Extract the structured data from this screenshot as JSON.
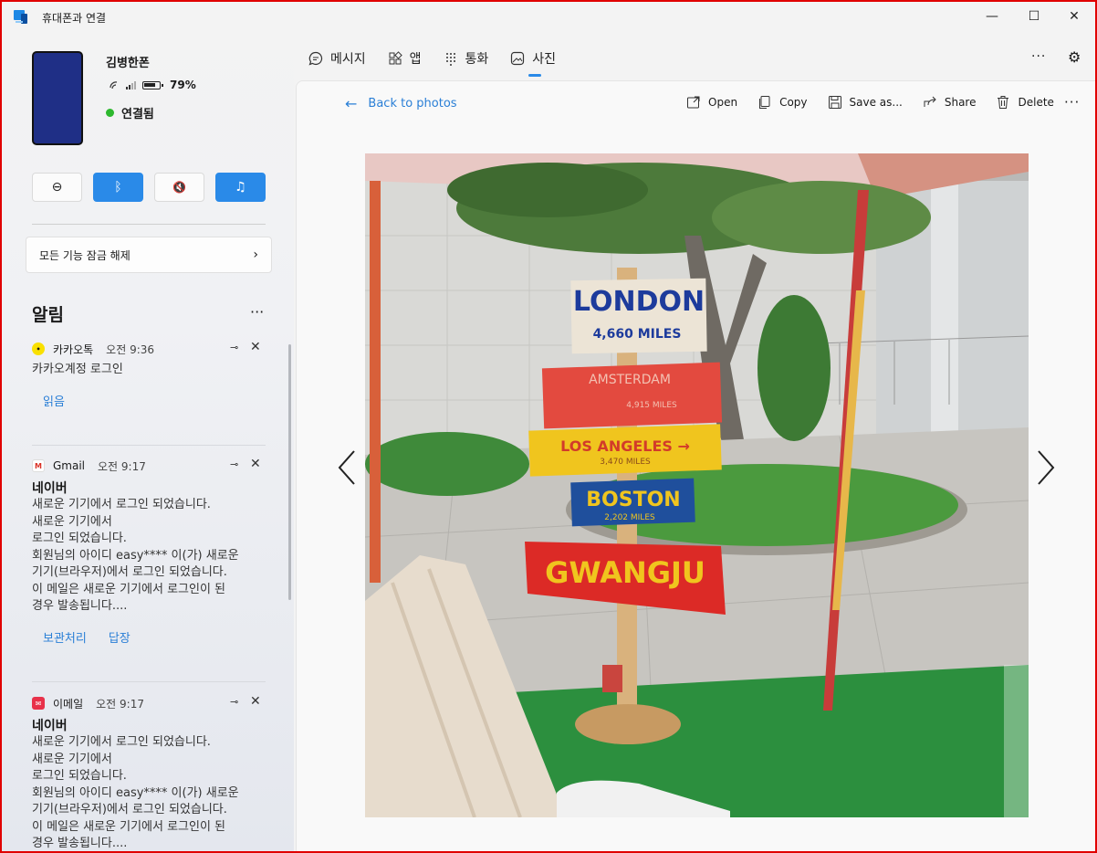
{
  "window": {
    "title": "휴대폰과 연결",
    "minimize": "—",
    "maximize": "☐",
    "close": "✕"
  },
  "phone": {
    "name": "김병한폰",
    "battery": "79%",
    "battery_level": 0.79,
    "status": "연결됨"
  },
  "quick_actions": [
    {
      "name": "dnd",
      "icon": "⊖",
      "active": false
    },
    {
      "name": "bluetooth",
      "icon": "ᛒ",
      "active": true
    },
    {
      "name": "mute",
      "icon": "🔇",
      "active": false
    },
    {
      "name": "music",
      "icon": "♫",
      "active": true
    }
  ],
  "unlock_label": "모든 기능 잠금 해제",
  "notifications": {
    "title": "알림",
    "items": [
      {
        "app": "카카오톡",
        "time": "오전 9:36",
        "icon_color": "#f9e000",
        "sender": "",
        "body": "카카오계정 로그인",
        "actions": [
          "읽음"
        ]
      },
      {
        "app": "Gmail",
        "time": "오전 9:17",
        "icon_color": "#ffffff",
        "sender": "네이버",
        "body": "새로운 기기에서 로그인 되었습니다.\n새로운 기기에서\n로그인 되었습니다.\n회원님의 아이디 easy**** 이(가) 새로운\n기기(브라우저)에서 로그인 되었습니다.\n이 메일은 새로운 기기에서 로그인이 된\n경우 발송됩니다....",
        "actions": [
          "보관처리",
          "답장"
        ]
      },
      {
        "app": "이메일",
        "time": "오전 9:17",
        "icon_color": "#e8314a",
        "sender": "네이버",
        "body": "새로운 기기에서 로그인 되었습니다.\n새로운 기기에서\n로그인 되었습니다.\n 회원님의 아이디 easy**** 이(가) 새로운\n기기(브라우저)에서 로그인 되었습니다.\n이 메일은 새로운 기기에서 로그인이 된\n경우 발송됩니다....",
        "actions": []
      }
    ]
  },
  "nav": {
    "messages": "메시지",
    "apps": "앱",
    "calls": "통화",
    "photos": "사진"
  },
  "photo_view": {
    "back": "Back to photos",
    "open": "Open",
    "copy": "Copy",
    "save": "Save as...",
    "share": "Share",
    "delete": "Delete",
    "signs": [
      "LONDON",
      "4,660 MILES",
      "AMSTERDAM",
      "4,915 MILES",
      "LOS ANGELES →",
      "3,470 MILES",
      "BOSTON",
      "2,202 MILES",
      "GWANGJU"
    ]
  },
  "colors": {
    "accent": "#2a8ae8",
    "link": "#2a7fd6",
    "frame": "#e00000"
  }
}
